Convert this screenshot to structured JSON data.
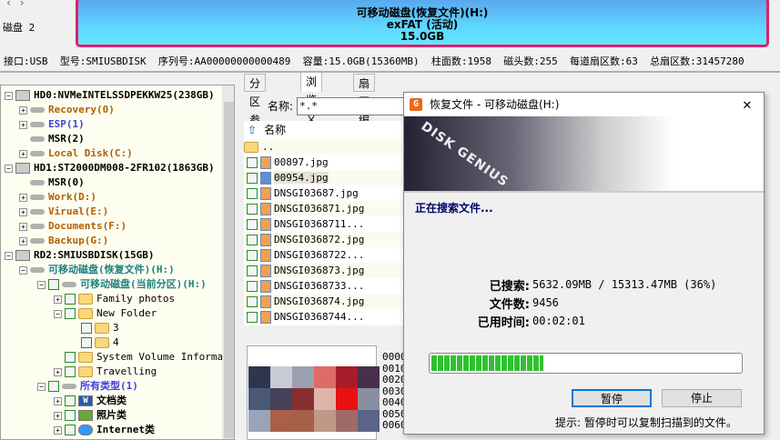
{
  "top": {
    "nav_arrows": "‹ ›",
    "disk_label": "磁盘 2",
    "partition": {
      "name": "可移动磁盘(恢复文件)(H:)",
      "fs": "exFAT (活动)",
      "size": "15.0GB"
    },
    "info": "接口:USB  型号:SMIUSBDISK  序列号:AA00000000000489  容量:15.0GB(15360MB)  柱面数:1958  磁头数:255  每道扇区数:63  总扇区数:31457280"
  },
  "tree": [
    {
      "label": "HD0:NVMeINTELSSDPEKKW25(238GB)",
      "color": "norm-bold",
      "level": 0,
      "type": "hdd"
    },
    {
      "label": "Recovery(0)",
      "color": "orange",
      "level": 1,
      "type": "disk"
    },
    {
      "label": "ESP(1)",
      "color": "blue",
      "level": 1,
      "type": "disk"
    },
    {
      "label": "MSR(2)",
      "color": "plain",
      "level": 1,
      "type": "disk"
    },
    {
      "label": "Local Disk(C:)",
      "color": "orange",
      "level": 1,
      "type": "disk"
    },
    {
      "label": "HD1:ST2000DM008-2FR102(1863GB)",
      "color": "plain",
      "level": 0,
      "type": "hdd"
    },
    {
      "label": "MSR(0)",
      "color": "plain",
      "level": 1,
      "type": "disk"
    },
    {
      "label": "Work(D:)",
      "color": "orange",
      "level": 1,
      "type": "disk"
    },
    {
      "label": "Virual(E:)",
      "color": "orange",
      "level": 1,
      "type": "disk"
    },
    {
      "label": "Documents(F:)",
      "color": "orange",
      "level": 1,
      "type": "disk"
    },
    {
      "label": "Backup(G:)",
      "color": "orange",
      "level": 1,
      "type": "disk"
    },
    {
      "label": "RD2:SMIUSBDISK(15GB)",
      "color": "plain",
      "level": 0,
      "type": "hdd"
    },
    {
      "label": "可移动磁盘(恢复文件)(H:)",
      "color": "teal",
      "level": 1,
      "type": "disk"
    },
    {
      "label": "可移动磁盘(当前分区)(H:)",
      "color": "teal",
      "level": 2,
      "type": "disk"
    },
    {
      "label": "Family photos",
      "level": 3,
      "type": "folder"
    },
    {
      "label": "New Folder",
      "level": 3,
      "type": "folder"
    },
    {
      "label": "3",
      "level": 4,
      "type": "folder"
    },
    {
      "label": "4",
      "level": 4,
      "type": "folder"
    },
    {
      "label": "System Volume Informat",
      "level": 3,
      "type": "folder"
    },
    {
      "label": "Travelling",
      "level": 3,
      "type": "folder"
    },
    {
      "label": "所有类型(1)",
      "color": "blue",
      "level": 2,
      "type": "disk"
    },
    {
      "label": "文档类",
      "level": 3,
      "type": "word"
    },
    {
      "label": "照片类",
      "level": 3,
      "type": "photo"
    },
    {
      "label": "Internet类",
      "level": 3,
      "type": "ie"
    }
  ],
  "tabs": [
    "分区参数",
    "浏览文件",
    "扇区编辑"
  ],
  "active_tab": "浏览文件",
  "filter": {
    "label": "名称:",
    "value": "*.*"
  },
  "list": {
    "header": "名称",
    "parent": "..",
    "files": [
      "00897.jpg",
      "00954.jpg",
      "DNSGI03687.jpg",
      "DNSGI036871.jpg",
      "DNSGI0368711...",
      "DNSGI036872.jpg",
      "DNSGI0368722...",
      "DNSGI036873.jpg",
      "DNSGI0368733...",
      "DNSGI036874.jpg",
      "DNSGI0368744..."
    ],
    "selected": "00954.jpg"
  },
  "hex_offsets": [
    "0000",
    "0010",
    "0020",
    "0030",
    "0040",
    "0050",
    "0060"
  ],
  "dialog": {
    "title": "恢复文件 - 可移动磁盘(H:)",
    "banner_text": "DISK GENIUS",
    "status": "正在搜索文件...",
    "searched_label": "已搜索:",
    "searched_value": "5632.09MB / 15313.47MB (36%)",
    "files_label": "文件数:",
    "files_value": "9456",
    "elapsed_label": "已用时间:",
    "elapsed_value": "00:02:01",
    "progress_percent": 36,
    "pause_label": "暂停",
    "stop_label": "停止",
    "hint": "提示: 暂停时可以复制扫描到的文件。"
  },
  "colors": {
    "partition_border": "#e0206a",
    "progress": "#30c030",
    "accent": "#0078d7"
  }
}
